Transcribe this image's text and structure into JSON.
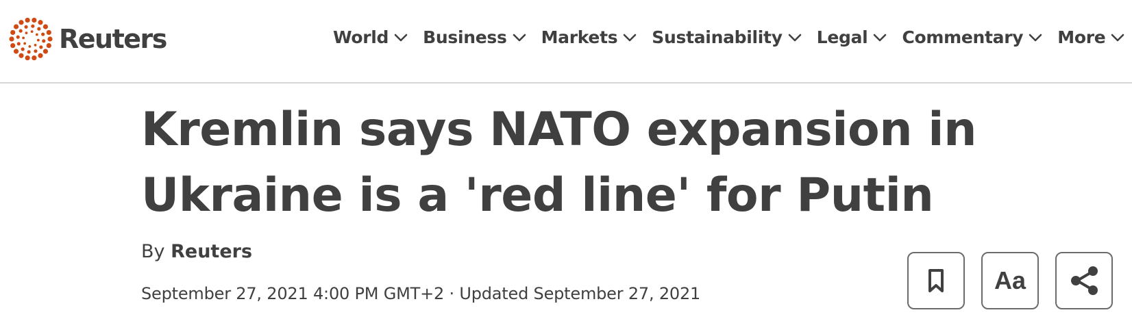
{
  "brand": {
    "name": "Reuters",
    "logo_color": "#d04a14"
  },
  "nav": {
    "items": [
      {
        "label": "World"
      },
      {
        "label": "Business"
      },
      {
        "label": "Markets"
      },
      {
        "label": "Sustainability"
      },
      {
        "label": "Legal"
      },
      {
        "label": "Commentary"
      },
      {
        "label": "More"
      }
    ]
  },
  "article": {
    "headline": "Kremlin says NATO expansion in Ukraine is a 'red line' for Putin",
    "byline_prefix": "By",
    "author": "Reuters",
    "dateline": "September 27, 2021 4:00 PM GMT+2 · Updated September 27, 2021"
  },
  "tools": {
    "text_size_label": "Aa",
    "icons": [
      "bookmark-icon",
      "text-size-icon",
      "share-icon"
    ]
  }
}
